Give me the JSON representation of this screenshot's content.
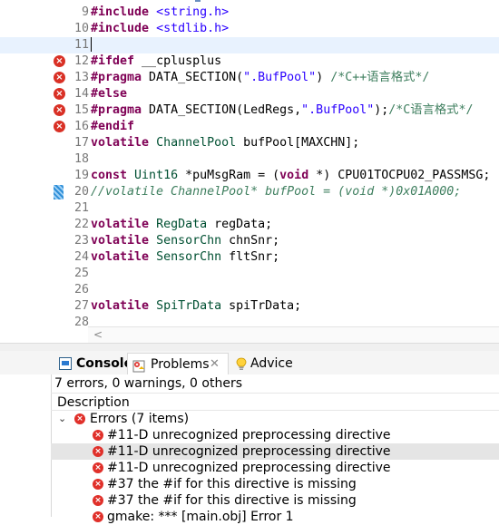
{
  "editor": {
    "lines": [
      {
        "num": "9",
        "tokens": [
          {
            "t": "#include",
            "c": "kw"
          },
          {
            "t": " "
          },
          {
            "t": "<string.h>",
            "c": "inc"
          }
        ]
      },
      {
        "num": "10",
        "tokens": [
          {
            "t": "#include",
            "c": "kw"
          },
          {
            "t": " "
          },
          {
            "t": "<stdlib.h>",
            "c": "inc"
          }
        ]
      },
      {
        "num": "11",
        "tokens": [],
        "current": true,
        "caret": true
      },
      {
        "num": "12",
        "marker": "error",
        "tokens": [
          {
            "t": "#ifdef",
            "c": "kw"
          },
          {
            "t": " __cplusplus"
          }
        ]
      },
      {
        "num": "13",
        "marker": "error",
        "tokens": [
          {
            "t": "#pragma",
            "c": "kw"
          },
          {
            "t": " DATA_SECTION("
          },
          {
            "t": "\".BufPool\"",
            "c": "str"
          },
          {
            "t": ") "
          },
          {
            "t": "/*C++语言格式*/",
            "c": "cmt"
          }
        ]
      },
      {
        "num": "14",
        "marker": "error",
        "tokens": [
          {
            "t": "#else",
            "c": "kw"
          }
        ]
      },
      {
        "num": "15",
        "marker": "error",
        "tokens": [
          {
            "t": "#pragma",
            "c": "kw"
          },
          {
            "t": " DATA_SECTION(LedRegs,"
          },
          {
            "t": "\".BufPool\"",
            "c": "str"
          },
          {
            "t": ");"
          },
          {
            "t": "/*C语言格式*/",
            "c": "cmt"
          }
        ]
      },
      {
        "num": "16",
        "marker": "error",
        "tokens": [
          {
            "t": "#endif",
            "c": "kw"
          }
        ]
      },
      {
        "num": "17",
        "tokens": [
          {
            "t": "volatile",
            "c": "kw"
          },
          {
            "t": " "
          },
          {
            "t": "ChannelPool",
            "c": "type"
          },
          {
            "t": " bufPool[MAXCHN];"
          }
        ]
      },
      {
        "num": "18",
        "tokens": []
      },
      {
        "num": "19",
        "tokens": [
          {
            "t": "const",
            "c": "kw"
          },
          {
            "t": " "
          },
          {
            "t": "Uint16",
            "c": "type"
          },
          {
            "t": " *puMsgRam = ("
          },
          {
            "t": "void",
            "c": "kw"
          },
          {
            "t": " *) CPU01TOCPU02_PASSMSG;"
          }
        ]
      },
      {
        "num": "20",
        "marker": "bookmark",
        "tokens": [
          {
            "t": "//volatile ChannelPool* bufPool = (void *)0x01A000;",
            "c": "cmt-it"
          }
        ]
      },
      {
        "num": "21",
        "tokens": []
      },
      {
        "num": "22",
        "tokens": [
          {
            "t": "volatile",
            "c": "kw"
          },
          {
            "t": " "
          },
          {
            "t": "RegData",
            "c": "type"
          },
          {
            "t": " regData;"
          }
        ]
      },
      {
        "num": "23",
        "tokens": [
          {
            "t": "volatile",
            "c": "kw"
          },
          {
            "t": " "
          },
          {
            "t": "SensorChn",
            "c": "type"
          },
          {
            "t": " chnSnr;"
          }
        ]
      },
      {
        "num": "24",
        "tokens": [
          {
            "t": "volatile",
            "c": "kw"
          },
          {
            "t": " "
          },
          {
            "t": "SensorChn",
            "c": "type"
          },
          {
            "t": " fltSnr;"
          }
        ]
      },
      {
        "num": "25",
        "tokens": []
      },
      {
        "num": "26",
        "tokens": []
      },
      {
        "num": "27",
        "tokens": [
          {
            "t": "volatile",
            "c": "kw"
          },
          {
            "t": " "
          },
          {
            "t": "SpiTrData",
            "c": "type"
          },
          {
            "t": " spiTrData;"
          }
        ]
      },
      {
        "num": "28",
        "tokens": []
      }
    ],
    "scroll_left_arrow": "<"
  },
  "tabs": {
    "console": "Console",
    "problems": "Problems",
    "problems_close": "✕",
    "advice": "Advice"
  },
  "problems": {
    "summary": "7 errors, 0 warnings, 0 others",
    "column_header": "Description",
    "group_label": "Errors (7 items)",
    "items": [
      "#11-D unrecognized preprocessing directive",
      "#11-D unrecognized preprocessing directive",
      "#11-D unrecognized preprocessing directive",
      "#37 the #if for this directive is missing",
      "#37 the #if for this directive is missing",
      "gmake: *** [main.obj] Error 1"
    ],
    "selected_index": 1
  },
  "icons": {
    "error": "error-icon",
    "bookmark": "bookmark-icon",
    "console": "console-icon",
    "problems": "problems-icon",
    "advice": "lightbulb-icon",
    "chevron": "chevron-down-icon"
  },
  "colors": {
    "keyword": "#7f0055",
    "string": "#2a00ff",
    "comment": "#3f7f5f",
    "type": "#005032",
    "error": "#e0302a",
    "current_line": "#e8f2fe",
    "selected_row": "#e5e5e5"
  }
}
